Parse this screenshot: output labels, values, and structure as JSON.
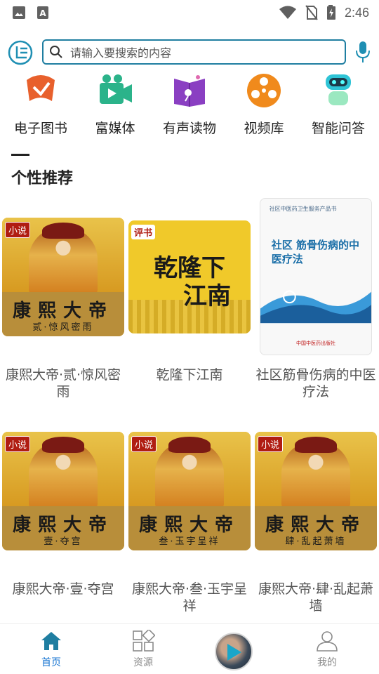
{
  "status_bar": {
    "time": "2:46",
    "left_icons": [
      "image-icon",
      "font-icon"
    ],
    "right_icons": [
      "wifi-icon",
      "sim-off-icon",
      "battery-charging-icon"
    ]
  },
  "header": {
    "logo_icon": "app-logo-icon",
    "search_placeholder": "请输入要搜索的内容",
    "mic_icon": "microphone-icon",
    "accent_color": "#1f7ea1"
  },
  "categories": [
    {
      "label": "电子图书",
      "icon": "ebook-icon",
      "color": "#e8602c"
    },
    {
      "label": "富媒体",
      "icon": "video-camera-icon",
      "color": "#2bb38a"
    },
    {
      "label": "有声读物",
      "icon": "audiobook-icon",
      "color": "#8a3fc2"
    },
    {
      "label": "视频库",
      "icon": "film-reel-icon",
      "color": "#f08a1c"
    },
    {
      "label": "智能问答",
      "icon": "robot-icon",
      "color": "#2fc4d6"
    }
  ],
  "section": {
    "title": "个性推荐"
  },
  "recommendations": [
    {
      "title": "康熙大帝·贰·惊风密雨",
      "cover_tag": "小说",
      "cover_title": "康熙大帝",
      "cover_subtitle": "贰·惊风密雨"
    },
    {
      "title": "乾隆下江南",
      "cover_tag": "评书",
      "cover_title_line1": "乾隆下",
      "cover_title_line2": "江南"
    },
    {
      "title": "社区筋骨伤病的中医疗法",
      "cover_series": "社区中医药卫生服务产品书",
      "cover_title": "社区 筋骨伤病的中医疗法",
      "cover_publisher": "中国中医药出版社"
    },
    {
      "title": "康熙大帝·壹·夺宫",
      "cover_tag": "小说",
      "cover_title": "康熙大帝",
      "cover_subtitle": "壹·夺宫"
    },
    {
      "title": "康熙大帝·叁·玉宇呈祥",
      "cover_tag": "小说",
      "cover_title": "康熙大帝",
      "cover_subtitle": "叁·玉宇呈祥"
    },
    {
      "title": "康熙大帝·肆·乱起萧墙",
      "cover_tag": "小说",
      "cover_title": "康熙大帝",
      "cover_subtitle": "肆·乱起萧墙"
    }
  ],
  "bottom_nav": {
    "items": [
      {
        "label": "首页",
        "icon": "home-icon",
        "active": true
      },
      {
        "label": "资源",
        "icon": "resources-grid-icon",
        "active": false
      },
      {
        "label": "",
        "icon": "play-icon",
        "active": false
      },
      {
        "label": "我的",
        "icon": "user-icon",
        "active": false
      }
    ],
    "active_color": "#1976d2"
  }
}
